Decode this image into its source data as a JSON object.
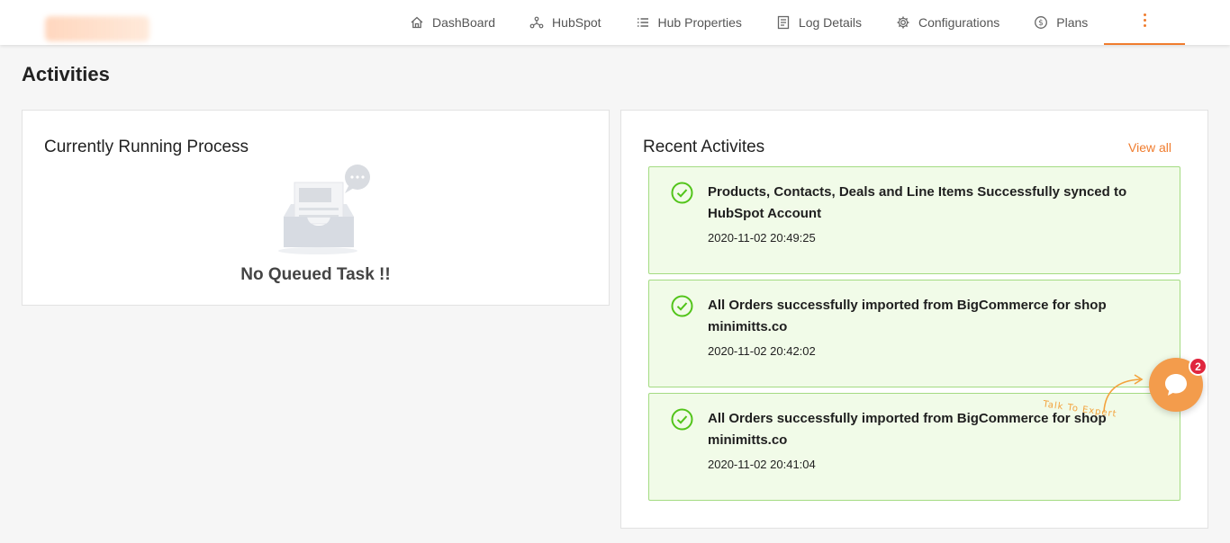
{
  "nav": {
    "items": [
      {
        "label": "DashBoard",
        "icon": "home-icon"
      },
      {
        "label": "HubSpot",
        "icon": "hubspot-icon"
      },
      {
        "label": "Hub Properties",
        "icon": "list-icon"
      },
      {
        "label": "Log Details",
        "icon": "document-icon"
      },
      {
        "label": "Configurations",
        "icon": "gear-icon"
      },
      {
        "label": "Plans",
        "icon": "dollar-icon"
      }
    ],
    "more_icon": "kebab-menu-icon"
  },
  "page": {
    "title": "Activities"
  },
  "running": {
    "title": "Currently Running Process",
    "empty_text": "No Queued Task !!",
    "empty_icon": "inbox-chat-illustration"
  },
  "recent": {
    "title": "Recent Activites",
    "view_all": "View all",
    "items": [
      {
        "text": "Products, Contacts, Deals and Line Items Successfully synced to HubSpot Account",
        "time": "2020-11-02 20:49:25",
        "status": "success"
      },
      {
        "text": "All Orders successfully imported from BigCommerce for shop minimitts.co",
        "time": "2020-11-02 20:42:02",
        "status": "success"
      },
      {
        "text": "All Orders successfully imported from BigCommerce for shop minimitts.co",
        "time": "2020-11-02 20:41:04",
        "status": "success"
      }
    ]
  },
  "chat": {
    "badge": "2",
    "label": "Talk To Expert",
    "icon": "chat-bubble-icon"
  },
  "colors": {
    "accent": "#f07c2e",
    "success_bg": "#f1fbe8",
    "success_border": "#a4db82",
    "success_icon": "#52c41a",
    "badge": "#e0263e"
  }
}
